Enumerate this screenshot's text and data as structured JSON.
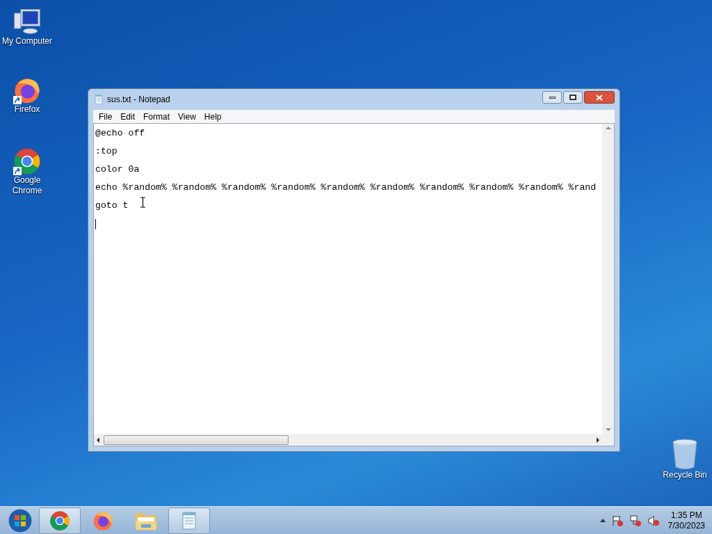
{
  "desktop_icons": [
    {
      "label": "My Computer",
      "kind": "computer",
      "shortcut": false
    },
    {
      "label": "Firefox",
      "kind": "firefox",
      "shortcut": true
    },
    {
      "label": "Google Chrome",
      "kind": "chrome",
      "shortcut": true
    },
    {
      "label": "Recycle Bin",
      "kind": "recycle",
      "shortcut": false
    }
  ],
  "window": {
    "title": "sus.txt - Notepad",
    "menu": [
      "File",
      "Edit",
      "Format",
      "View",
      "Help"
    ],
    "lines": [
      "@echo off",
      ":top",
      "color 0a",
      "echo %random% %random% %random% %random% %random% %random% %random% %random% %random% %rand",
      "goto t"
    ]
  },
  "taskbar": {
    "apps": [
      {
        "kind": "chrome",
        "open": true
      },
      {
        "kind": "firefox",
        "open": false
      },
      {
        "kind": "explorer",
        "open": false
      },
      {
        "kind": "notepad",
        "open": true
      }
    ],
    "clock": {
      "time": "1:35 PM",
      "date": "7/30/2023"
    }
  }
}
